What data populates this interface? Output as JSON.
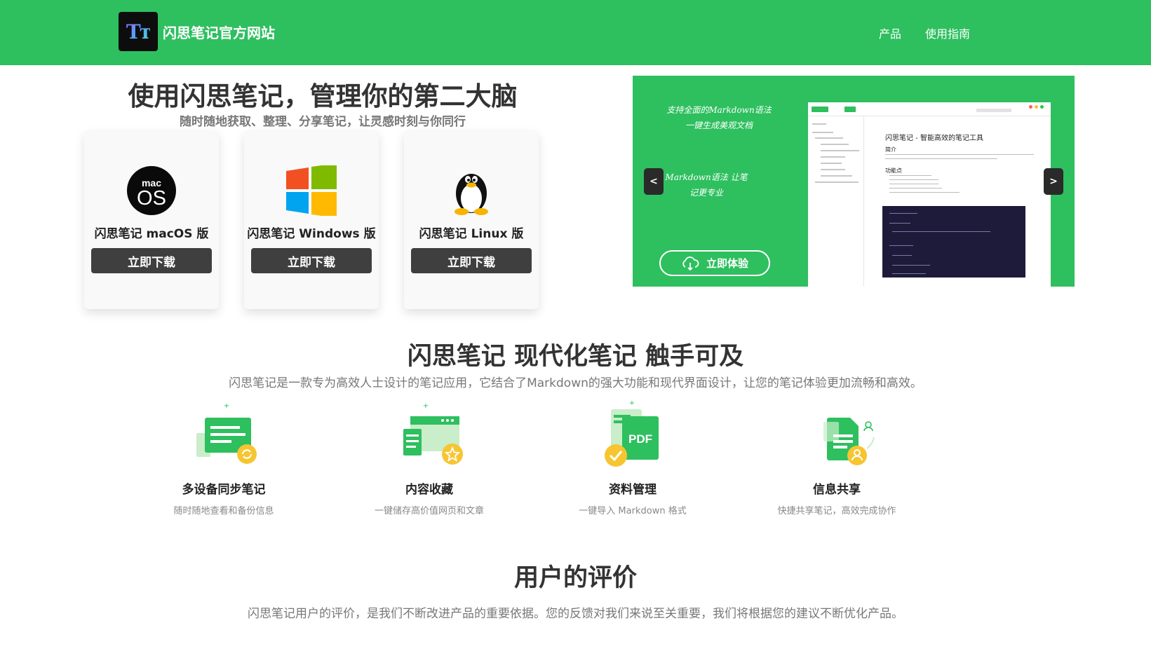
{
  "header": {
    "logo_text": "Tт",
    "site_name": "闪思笔记官方网站",
    "nav": [
      "产品",
      "使用指南"
    ]
  },
  "hero": {
    "title": "使用闪思笔记，管理你的第二大脑",
    "subtitle": "随时随地获取、整理、分享笔记，让灵感时刻与你同行",
    "downloads": [
      {
        "icon": "macos-icon",
        "name": "闪思笔记 macOS 版",
        "button": "立即下载"
      },
      {
        "icon": "windows-icon",
        "name": "闪思笔记 Windows 版",
        "button": "立即下载"
      },
      {
        "icon": "linux-tux-icon",
        "name": "闪思笔记 Linux 版",
        "button": "立即下载"
      }
    ]
  },
  "carousel": {
    "text_1a": "支持全面的Markdown语法",
    "text_1b": "一键生成美观文档",
    "text_2a": "Markdown语法 让笔",
    "text_2b": "记更专业",
    "prev": "<",
    "next": ">",
    "try_button": "立即体验",
    "screenshot": {
      "doc_title": "闪思笔记 - 智能高效的笔记工具",
      "heading_intro": "简介",
      "heading_features": "功能点"
    }
  },
  "features": {
    "title": "闪思笔记 现代化笔记 触手可及",
    "description": "闪思笔记是一款专为高效人士设计的笔记应用，它结合了Markdown的强大功能和现代界面设计，让您的笔记体验更加流畅和高效。",
    "items": [
      {
        "icon": "sync-notes-icon",
        "title": "多设备同步笔记",
        "desc": "随时随地查看和备份信息"
      },
      {
        "icon": "collect-star-icon",
        "title": "内容收藏",
        "desc": "一键储存高价值网页和文章"
      },
      {
        "icon": "pdf-document-icon",
        "title": "资料管理",
        "desc": "一键导入 Markdown 格式"
      },
      {
        "icon": "share-user-icon",
        "title": "信息共享",
        "desc": "快捷共享笔记，高效完成协作"
      }
    ]
  },
  "reviews": {
    "title": "用户的评价",
    "description": "闪思笔记用户的评价，是我们不断改进产品的重要依据。您的反馈对我们来说至关重要，我们将根据您的建议不断优化产品。"
  },
  "colors": {
    "brand_green": "#2ebf5f",
    "button_dark": "#3f3f3f",
    "accent_yellow": "#f7c531"
  }
}
